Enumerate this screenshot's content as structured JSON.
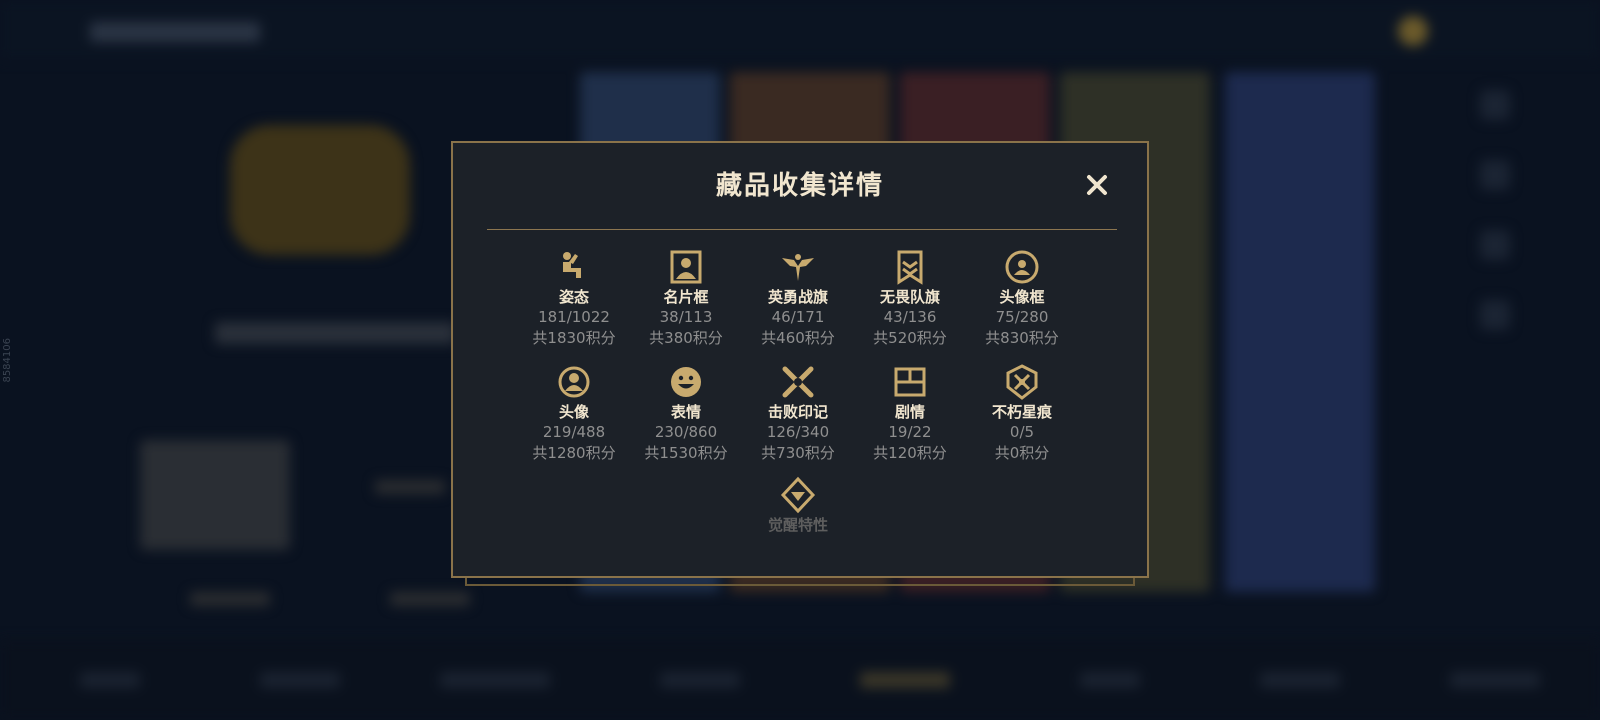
{
  "background": {
    "side_id": "8584106"
  },
  "dialog": {
    "title": "藏品收集详情",
    "close_label": "✕",
    "items": [
      {
        "name": "姿态",
        "count": "181/1022",
        "points": "共1830积分",
        "icon": "pose-icon"
      },
      {
        "name": "名片框",
        "count": "38/113",
        "points": "共380积分",
        "icon": "card-frame-icon"
      },
      {
        "name": "英勇战旗",
        "count": "46/171",
        "points": "共460积分",
        "icon": "banner-icon"
      },
      {
        "name": "无畏队旗",
        "count": "43/136",
        "points": "共520积分",
        "icon": "team-flag-icon"
      },
      {
        "name": "头像框",
        "count": "75/280",
        "points": "共830积分",
        "icon": "avatar-frame-icon"
      },
      {
        "name": "头像",
        "count": "219/488",
        "points": "共1280积分",
        "icon": "avatar-icon"
      },
      {
        "name": "表情",
        "count": "230/860",
        "points": "共1530积分",
        "icon": "emote-icon"
      },
      {
        "name": "击败印记",
        "count": "126/340",
        "points": "共730积分",
        "icon": "defeat-mark-icon"
      },
      {
        "name": "剧情",
        "count": "19/22",
        "points": "共120积分",
        "icon": "story-icon"
      },
      {
        "name": "不朽星痕",
        "count": "0/5",
        "points": "共0积分",
        "icon": "star-scar-icon"
      }
    ],
    "extra_item": {
      "name": "觉醒特性",
      "icon": "awakening-icon"
    }
  },
  "colors": {
    "gold": "#c8aa6e",
    "title": "#f1e6cf",
    "muted": "#8f8f8f",
    "dialog_bg": "#1c2128",
    "border": "#8a734a"
  }
}
